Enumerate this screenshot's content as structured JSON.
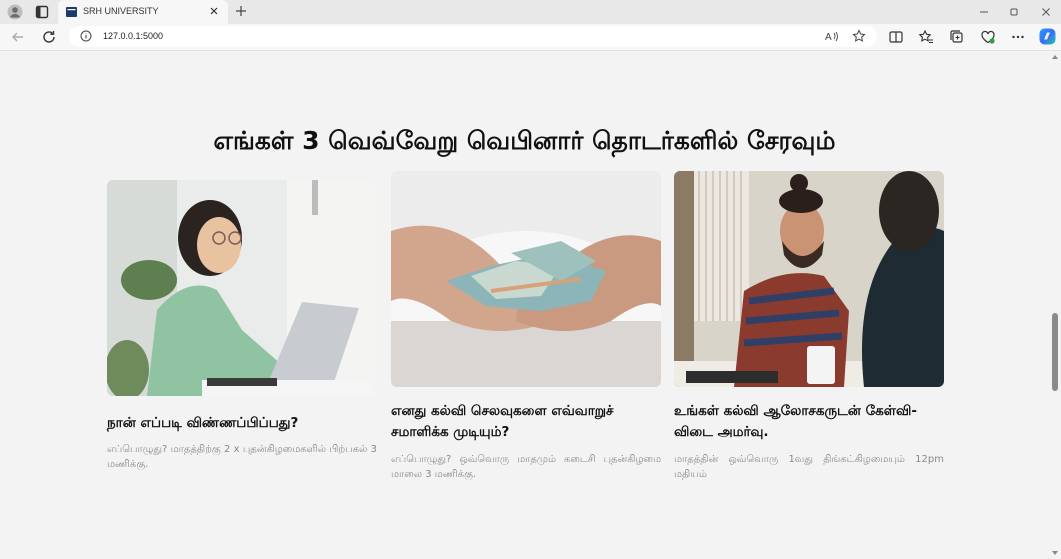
{
  "browser": {
    "tab_title": "SRH UNIVERSITY",
    "url": "127.0.0.1:5000"
  },
  "page": {
    "heading": "எங்கள் 3 வெவ்வேறு வெபினார் தொடர்களில் சேரவும்",
    "cards": [
      {
        "image": "woman-with-laptop-photo",
        "title": "நான் எப்படி விண்ணப்பிப்பது?",
        "text": "எப்பொழுது? மாதத்திற்கு 2 x புதன்கிழமைகளில் பிற்பகல் 3 மணிக்கு."
      },
      {
        "image": "hands-holding-money-photo",
        "title": "எனது கல்வி செலவுகளை எவ்வாறுச் சமாளிக்க முடியும்?",
        "text": "எப்பொழுது? ஒவ்வொரு மாதமும் கடைசி புதன்கிழமை மாலை 3 மணிக்கு."
      },
      {
        "image": "smiling-man-in-cafe-photo",
        "title": "உங்கள் கல்வி ஆலோசகருடன் கேள்வி-விடை அமர்வு.",
        "text": "மாதத்தின் ஒவ்வொரு 1வது திங்கட்கிழமையும் 12pm மதியம்"
      }
    ]
  },
  "colors": {
    "page_background": "#f3f3f3",
    "heading": "#111111",
    "card_text": "#8a8a8a"
  }
}
